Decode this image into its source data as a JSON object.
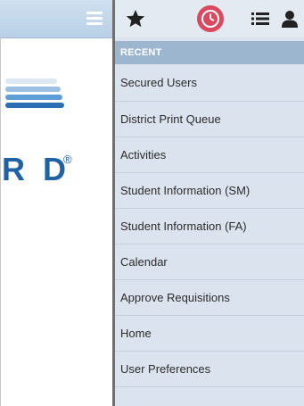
{
  "app": {
    "logo_text": "R D",
    "logo_reg": "®",
    "logo_stripe_colors": [
      "#dde7f1",
      "#9cc0e2",
      "#5e9fd8",
      "#2a6fb3"
    ]
  },
  "toolbar": {
    "icons": [
      "hamburger-icon",
      "star-icon",
      "clock-icon",
      "list-icon",
      "user-icon"
    ],
    "active_icon": "clock-icon"
  },
  "nav": {
    "section_header": "RECENT",
    "items": [
      {
        "label": "Secured Users"
      },
      {
        "label": "District Print Queue"
      },
      {
        "label": "Activities"
      },
      {
        "label": "Student Information (SM)"
      },
      {
        "label": "Student Information (FA)"
      },
      {
        "label": "Calendar"
      },
      {
        "label": "Approve Requisitions"
      },
      {
        "label": "Home"
      },
      {
        "label": "User Preferences"
      }
    ]
  },
  "colors": {
    "accent": "#d9495f",
    "header_bg": "#9db6d0",
    "panel_bg": "#dbe4ee",
    "logo_blue": "#1f63a4"
  }
}
